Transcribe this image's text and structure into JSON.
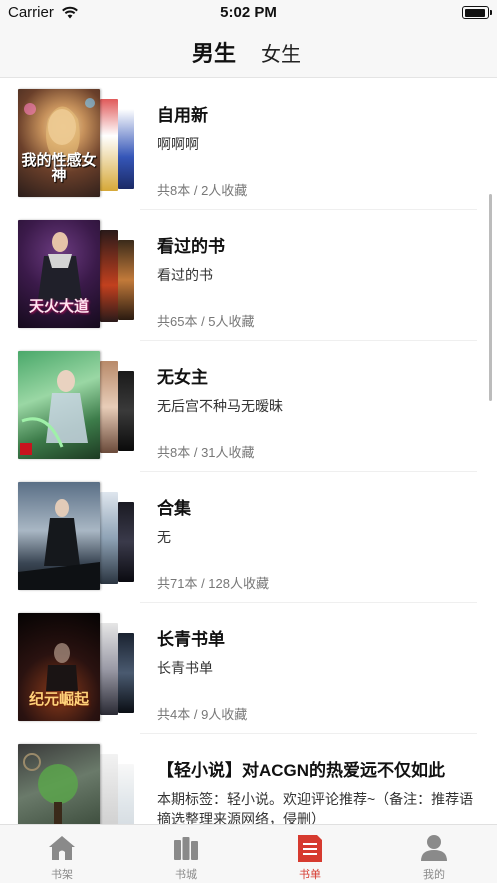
{
  "status_bar": {
    "carrier": "Carrier",
    "time": "5:02 PM"
  },
  "header": {
    "tab_male": "男生",
    "tab_female": "女生"
  },
  "booklists": [
    {
      "title": "自用新",
      "desc": "啊啊啊",
      "meta": "共8本 / 2人收藏",
      "cover_text": "我的性感女神"
    },
    {
      "title": "看过的书",
      "desc": "看过的书",
      "meta": "共65本 / 5人收藏",
      "cover_text": "天火大道"
    },
    {
      "title": "无女主",
      "desc": "无后宫不种马无暧昧",
      "meta": "共8本 / 31人收藏",
      "cover_text": ""
    },
    {
      "title": "合集",
      "desc": "无",
      "meta": "共71本 / 128人收藏",
      "cover_text": ""
    },
    {
      "title": "长青书单",
      "desc": "长青书单",
      "meta": "共4本 / 9人收藏",
      "cover_text": "纪元崛起"
    },
    {
      "title": "【轻小说】对ACGN的热爱远不仅如此",
      "desc": "本期标签：轻小说。欢迎评论推荐~（备注：推荐语摘选整理来源网络，侵删）",
      "meta": "",
      "cover_text": ""
    }
  ],
  "tabbar": {
    "items": [
      {
        "label": "书架",
        "icon": "house-icon"
      },
      {
        "label": "书城",
        "icon": "books-icon"
      },
      {
        "label": "书单",
        "icon": "list-doc-icon"
      },
      {
        "label": "我的",
        "icon": "person-icon"
      }
    ],
    "active_index": 2,
    "active_color": "#d63a2f",
    "inactive_color": "#8a8a8a"
  }
}
